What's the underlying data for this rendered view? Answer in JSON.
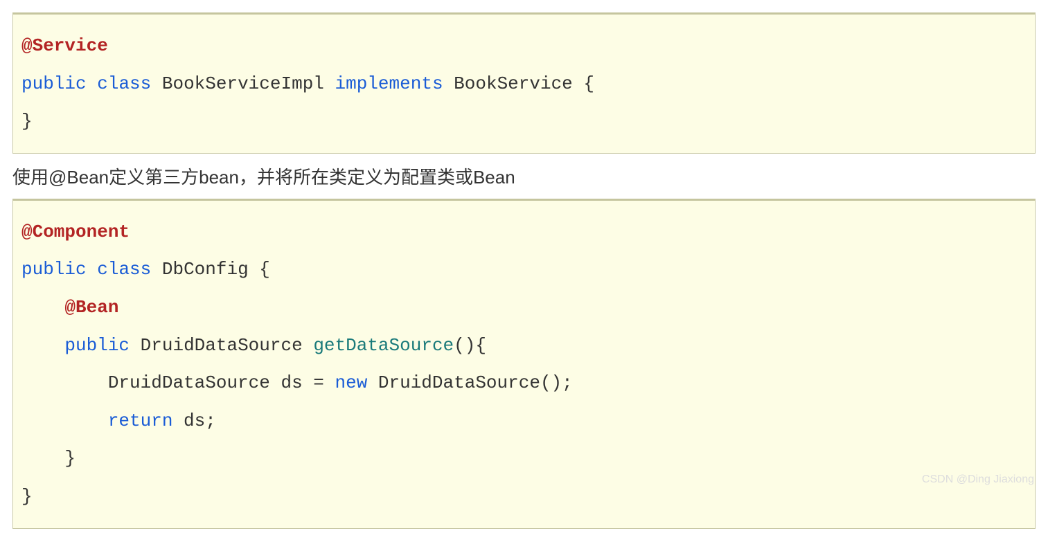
{
  "block1": {
    "line1_anno": "@Service",
    "line2_kw1": "public",
    "line2_kw2": "class",
    "line2_name": "BookServiceImpl",
    "line2_kw3": "implements",
    "line2_iface": "BookService {",
    "line3": "}"
  },
  "description": "使用@Bean定义第三方bean，并将所在类定义为配置类或Bean",
  "block2": {
    "line1_anno": "@Component",
    "line2_kw1": "public",
    "line2_kw2": "class",
    "line2_name": "DbConfig {",
    "line3_anno": "    @Bean",
    "line4_indent": "    ",
    "line4_kw1": "public",
    "line4_type": "DruidDataSource",
    "line4_method": "getDataSource",
    "line4_end": "(){",
    "line5_indent": "        ",
    "line5_a": "DruidDataSource ds = ",
    "line5_kw": "new",
    "line5_b": " DruidDataSource();",
    "line6_indent": "        ",
    "line6_kw": "return",
    "line6_rest": " ds;",
    "line7": "    }",
    "line8": "}"
  },
  "watermark": "CSDN @Ding Jiaxiong"
}
